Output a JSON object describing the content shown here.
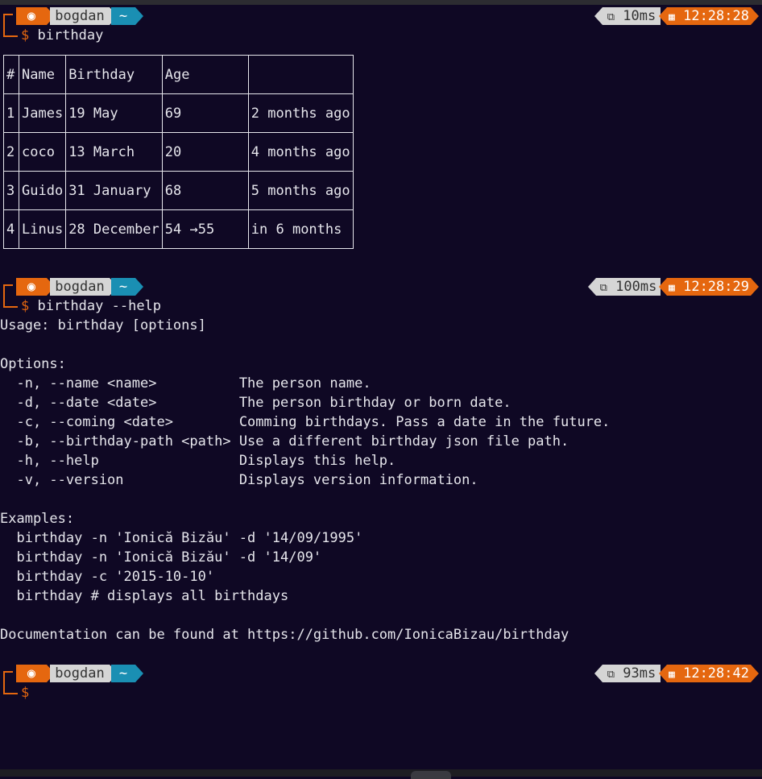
{
  "prompts": [
    {
      "user": "bogdan",
      "dir": "~",
      "symbol": "$",
      "command": "birthday",
      "duration": "10ms",
      "time": "12:28:28"
    },
    {
      "user": "bogdan",
      "dir": "~",
      "symbol": "$",
      "command": "birthday --help",
      "duration": "100ms",
      "time": "12:28:29"
    },
    {
      "user": "bogdan",
      "dir": "~",
      "symbol": "$",
      "command": "",
      "duration": "93ms",
      "time": "12:28:42"
    }
  ],
  "icons": {
    "ubuntu": "◉",
    "duration": "⧉",
    "calendar": "▦"
  },
  "table": {
    "headers": [
      "#",
      "Name",
      "Birthday",
      "Age",
      ""
    ],
    "rows": [
      [
        "1",
        "James",
        "19 May",
        "69",
        "2 months ago"
      ],
      [
        "2",
        "coco",
        "13 March",
        "20",
        "4 months ago"
      ],
      [
        "3",
        "Guido",
        "31 January",
        "68",
        "5 months ago"
      ],
      [
        "4",
        "Linus",
        "28 December",
        "54 →55",
        "in 6 months"
      ]
    ]
  },
  "help": {
    "usage": "Usage: birthday [options]",
    "options_title": "Options:",
    "options": [
      {
        "flag": "  -n, --name <name>          ",
        "desc": "The person name."
      },
      {
        "flag": "  -d, --date <date>          ",
        "desc": "The person birthday or born date."
      },
      {
        "flag": "  -c, --coming <date>        ",
        "desc": "Comming birthdays. Pass a date in the future."
      },
      {
        "flag": "  -b, --birthday-path <path> ",
        "desc": "Use a different birthday json file path."
      },
      {
        "flag": "  -h, --help                 ",
        "desc": "Displays this help."
      },
      {
        "flag": "  -v, --version              ",
        "desc": "Displays version information."
      }
    ],
    "examples_title": "Examples:",
    "examples": [
      "  birthday -n 'Ionică Bizău' -d '14/09/1995'",
      "  birthday -n 'Ionică Bizău' -d '14/09'",
      "  birthday -c '2015-10-10'",
      "  birthday # displays all birthdays"
    ],
    "documentation": "Documentation can be found at https://github.com/IonicaBizau/birthday"
  },
  "colors": {
    "background": "#0f0824",
    "accent_orange": "#e5670f",
    "accent_cyan": "#1a8fb3",
    "segment_gray": "#d5d5d5",
    "text": "#e6e6ec"
  }
}
